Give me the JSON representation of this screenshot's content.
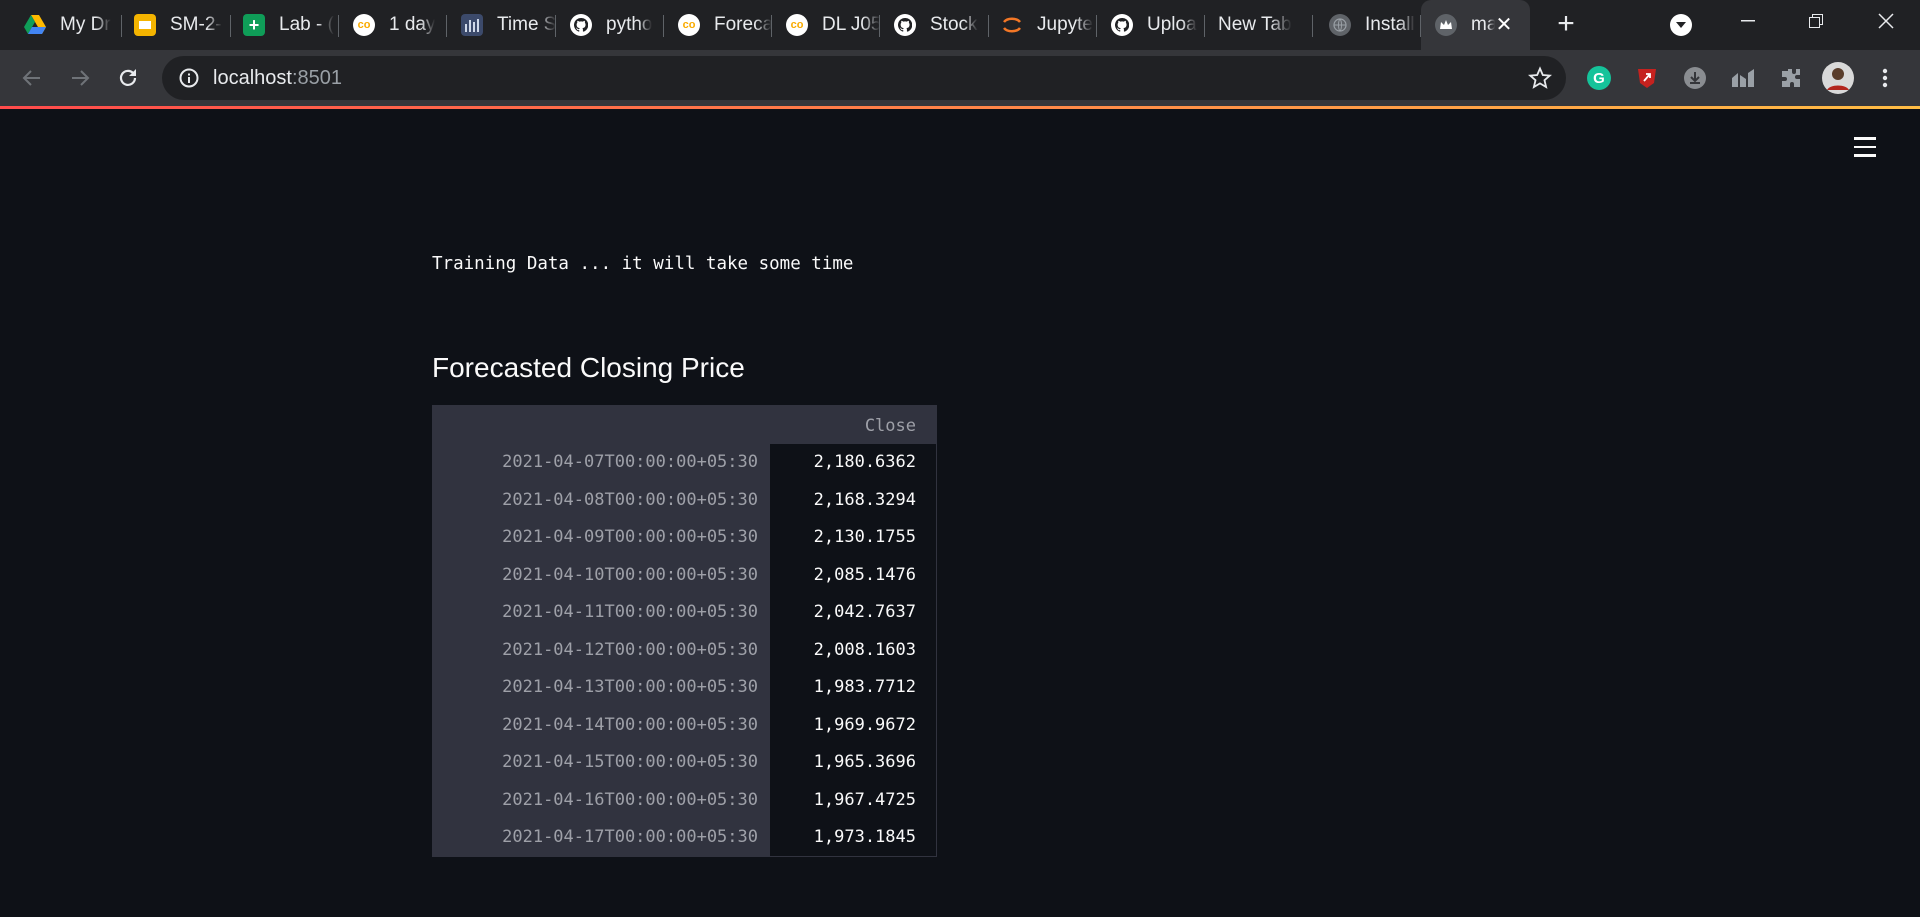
{
  "browser": {
    "tabs": [
      {
        "title": "My Dr",
        "icon": "google-drive-icon"
      },
      {
        "title": "SM-2-",
        "icon": "google-slides-icon"
      },
      {
        "title": "Lab - (",
        "icon": "google-sheets-icon"
      },
      {
        "title": "1 day",
        "icon": "colab-icon"
      },
      {
        "title": "Time S",
        "icon": "chart-bars-icon"
      },
      {
        "title": "pytho",
        "icon": "github-icon"
      },
      {
        "title": "Foreca",
        "icon": "colab-icon"
      },
      {
        "title": "DL J05",
        "icon": "colab-icon"
      },
      {
        "title": "Stock",
        "icon": "github-icon"
      },
      {
        "title": "Jupyte",
        "icon": "jupyter-icon"
      },
      {
        "title": "Uploa",
        "icon": "github-icon"
      },
      {
        "title": "New Tab",
        "icon": ""
      },
      {
        "title": "Install",
        "icon": "globe-icon"
      },
      {
        "title": "ma",
        "icon": "streamlit-crown-icon"
      }
    ],
    "url_host": "localhost",
    "url_port": ":8501",
    "colors": {
      "tabstrip": "#202124",
      "toolbar": "#35363a",
      "omnibox": "#202124",
      "accent_start": "#ff4b4b",
      "accent_end": "#ffbd45"
    }
  },
  "page": {
    "training_text": "Training Data ... it will take some time",
    "forecast_title": "Forecasted Closing Price",
    "table": {
      "column_header": "Close",
      "rows": [
        {
          "index": "2021-04-07T00:00:00+05:30",
          "value": "2,180.6362"
        },
        {
          "index": "2021-04-08T00:00:00+05:30",
          "value": "2,168.3294"
        },
        {
          "index": "2021-04-09T00:00:00+05:30",
          "value": "2,130.1755"
        },
        {
          "index": "2021-04-10T00:00:00+05:30",
          "value": "2,085.1476"
        },
        {
          "index": "2021-04-11T00:00:00+05:30",
          "value": "2,042.7637"
        },
        {
          "index": "2021-04-12T00:00:00+05:30",
          "value": "2,008.1603"
        },
        {
          "index": "2021-04-13T00:00:00+05:30",
          "value": "1,983.7712"
        },
        {
          "index": "2021-04-14T00:00:00+05:30",
          "value": "1,969.9672"
        },
        {
          "index": "2021-04-15T00:00:00+05:30",
          "value": "1,965.3696"
        },
        {
          "index": "2021-04-16T00:00:00+05:30",
          "value": "1,967.4725"
        },
        {
          "index": "2021-04-17T00:00:00+05:30",
          "value": "1,973.1845"
        }
      ]
    },
    "colors": {
      "background": "#0e1117",
      "table_header": "#31333f",
      "text": "#fafafa",
      "muted_text": "#9ea0a8"
    }
  }
}
